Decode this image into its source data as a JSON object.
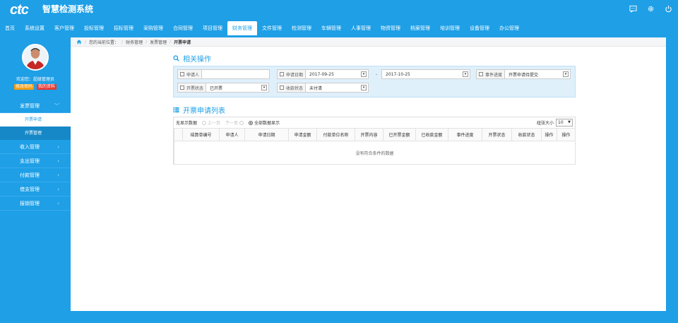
{
  "app": {
    "logo": "ctc",
    "title": "智慧检测系统"
  },
  "nav": [
    {
      "label": "首页"
    },
    {
      "label": "系统设置"
    },
    {
      "label": "客户管理"
    },
    {
      "label": "投标管理"
    },
    {
      "label": "招标管理"
    },
    {
      "label": "采购管理"
    },
    {
      "label": "合同管理"
    },
    {
      "label": "项目管理"
    },
    {
      "label": "财务管理",
      "active": true
    },
    {
      "label": "文件管理"
    },
    {
      "label": "检测管理"
    },
    {
      "label": "车辆管理"
    },
    {
      "label": "人事管理"
    },
    {
      "label": "物资管理"
    },
    {
      "label": "档案管理"
    },
    {
      "label": "培训管理"
    },
    {
      "label": "设备管理"
    },
    {
      "label": "办公管理"
    }
  ],
  "header_icons": [
    "message-icon",
    "gear-icon",
    "power-icon"
  ],
  "profile": {
    "welcome": "欢迎您：超级管理员",
    "change_password": "修改密码",
    "my_profile": "我的资料"
  },
  "sidebar": {
    "group_invoice": "发票管理",
    "sub_apply": "开票申请",
    "sub_manage": "开票管理",
    "group_income": "收入管理",
    "group_expense": "支出管理",
    "group_payment": "付款管理",
    "group_loan": "借支管理",
    "group_reimburse": "报销管理"
  },
  "breadcrumb": {
    "prefix": "您的当前位置：",
    "l1": "财务管理",
    "l2": "发票管理",
    "l3": "开票申请"
  },
  "search": {
    "title": "相关操作",
    "applicant_label": "申请人",
    "applicant_value": "",
    "date_label": "申请日期",
    "date_from": "2017-09-25",
    "date_to": "2017-10-25",
    "progress_label": "事件进度",
    "progress_value": "开票申请待提交",
    "invoice_status_label": "开票状态",
    "invoice_status_value": "已开票",
    "receipt_status_label": "收款状态",
    "receipt_status_value": "未付清",
    "dash": "-"
  },
  "list": {
    "title": "开票申请列表",
    "no_data": "无显示数据",
    "prev": "上一页",
    "next": "下一页",
    "show_all": "全部数据显示",
    "page_size_label": "纽张大小",
    "page_size": "10",
    "columns": [
      "",
      "结算单编号",
      "申请人",
      "申请日期",
      "申请金额",
      "付款单位名称",
      "开票内容",
      "已开票金额",
      "已收款金额",
      "事件进度",
      "开票状态",
      "收款状态",
      "操作",
      "操作"
    ],
    "empty_message": "没有符合条件的数据"
  },
  "colors": {
    "primary": "#1e9fe6",
    "search_bg": "#dff0fb"
  }
}
